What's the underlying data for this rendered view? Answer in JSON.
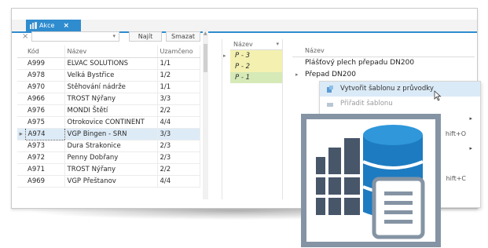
{
  "tab": {
    "label": "Akce",
    "close": "×"
  },
  "filter": {
    "clear_icon": "×",
    "combo_value": "",
    "combo_arrow": "▾",
    "find_label": "Najít",
    "clear_label": "Smazat"
  },
  "grid": {
    "columns": [
      "Kód",
      "Název",
      "Uzamčeno"
    ],
    "rows": [
      {
        "kod": "A999",
        "nazev": "ELVAC SOLUTIONS",
        "uz": "1/1",
        "selected": false
      },
      {
        "kod": "A978",
        "nazev": "Velká Bystřice",
        "uz": "1/2",
        "selected": false
      },
      {
        "kod": "A970",
        "nazev": "Stěhování nádrže",
        "uz": "1/1",
        "selected": false
      },
      {
        "kod": "A966",
        "nazev": "TROST Nýřany",
        "uz": "3/3",
        "selected": false
      },
      {
        "kod": "A976",
        "nazev": "MONDI Štětí",
        "uz": "2/2",
        "selected": false
      },
      {
        "kod": "A975",
        "nazev": "Otrokovice CONTINENT",
        "uz": "4/4",
        "selected": false
      },
      {
        "kod": "A974",
        "nazev": "VGP Bingen - SRN",
        "uz": "3/3",
        "selected": true
      },
      {
        "kod": "A973",
        "nazev": "Dura Strakonice",
        "uz": "2/3",
        "selected": false
      },
      {
        "kod": "A972",
        "nazev": "Penny Dobřany",
        "uz": "2/3",
        "selected": false
      },
      {
        "kod": "A971",
        "nazev": "TROST Nýřany",
        "uz": "2/2",
        "selected": false
      },
      {
        "kod": "A969",
        "nazev": "VGP Přeštanov",
        "uz": "4/4",
        "selected": false
      }
    ],
    "row_indicator": "▸"
  },
  "middle": {
    "header": "Název",
    "arrow": "▾",
    "rows": [
      {
        "label": "P - 3",
        "color": "#f4f1b0",
        "indicator": "▸"
      },
      {
        "label": "P - 2",
        "color": "#f4f1b0",
        "indicator": ""
      },
      {
        "label": "P - 1",
        "color": "#d6eab8",
        "indicator": ""
      }
    ]
  },
  "right": {
    "header": "Název",
    "rows": [
      {
        "label": "Plášťový plech přepadu DN200",
        "indicator": ""
      },
      {
        "label": "Přepad DN200",
        "indicator": "▸"
      }
    ]
  },
  "menu": {
    "items": [
      {
        "label": "Vytvořit šablonu z průvodky",
        "state": "hover",
        "submenu": "",
        "shortcut": ""
      },
      {
        "label": "Přiřadit šablonu",
        "state": "disabled",
        "submenu": "",
        "shortcut": ""
      },
      {
        "label": "",
        "state": "normal",
        "submenu": "▸",
        "shortcut": ""
      },
      {
        "label": "",
        "state": "normal",
        "submenu": "",
        "shortcut": "hift+O"
      },
      {
        "label": "",
        "state": "normal",
        "submenu": "▸",
        "shortcut": ""
      },
      {
        "label": "",
        "state": "normal",
        "submenu": "",
        "shortcut": ""
      },
      {
        "label": "",
        "state": "normal",
        "submenu": "",
        "shortcut": "hift+C"
      }
    ]
  },
  "colors": {
    "accent": "#2f8ccf",
    "selection": "#ddebf7",
    "logo_frame": "#8594a4",
    "logo_blue": "#1d7bc1",
    "logo_slate": "#48566a"
  },
  "icons": {
    "tab": "database-icon",
    "cursor": "mouse-pointer-icon",
    "logo": "database-document-logo"
  }
}
